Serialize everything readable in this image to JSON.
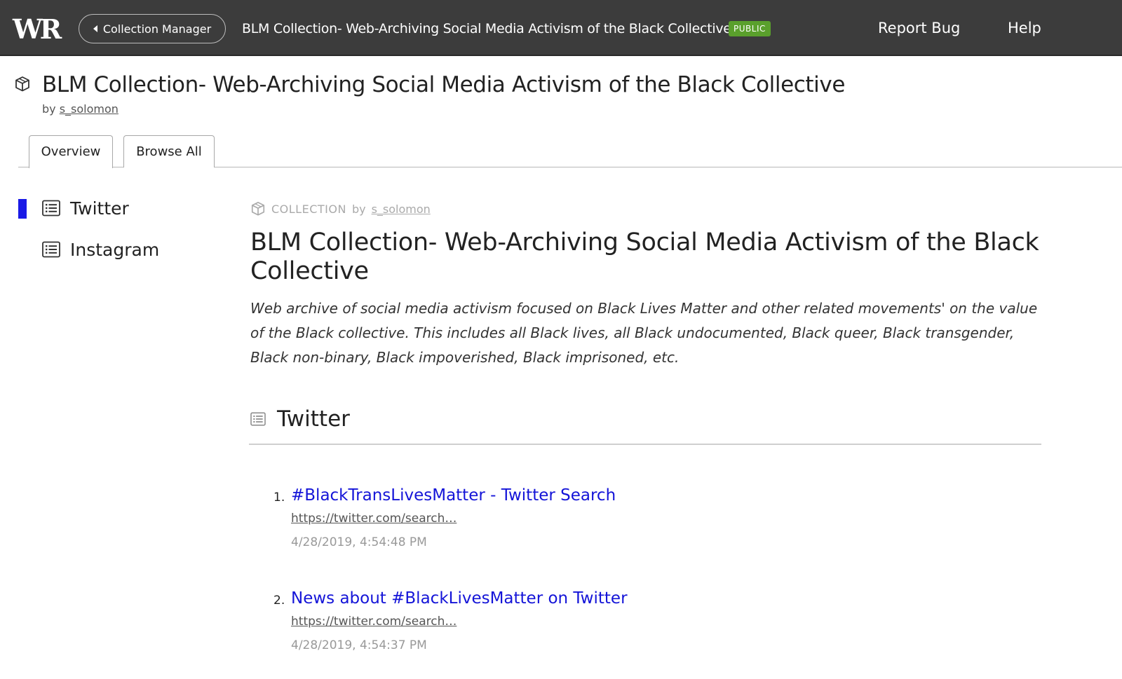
{
  "topbar": {
    "logo": "WR",
    "collection_manager_label": "Collection Manager",
    "title": "BLM Collection- Web-Archiving Social Media Activism of the Black Collective",
    "badge": "PUBLIC",
    "report_bug": "Report Bug",
    "help": "Help"
  },
  "header": {
    "title": "BLM Collection- Web-Archiving Social Media Activism of the Black Collective",
    "by_label": "by",
    "author": "s_solomon"
  },
  "tabs": [
    {
      "label": "Overview",
      "active": true
    },
    {
      "label": "Browse All",
      "active": false
    }
  ],
  "sidebar": {
    "items": [
      {
        "label": "Twitter",
        "active": true,
        "icon": "list-icon"
      },
      {
        "label": "Instagram",
        "active": false,
        "icon": "list-icon"
      }
    ]
  },
  "content": {
    "meta_type": "COLLECTION",
    "meta_by": "by",
    "meta_author": "s_solomon",
    "title": "BLM Collection- Web-Archiving Social Media Activism of the Black Collective",
    "description": "Web archive of social media activism focused on Black Lives Matter and other related movements' on the value of the Black collective. This includes all Black lives, all Black undocumented, Black queer, Black transgender, Black non-binary, Black impoverished, Black imprisoned, etc.",
    "section_title": "Twitter",
    "entries": [
      {
        "num": "1.",
        "title": "#BlackTransLivesMatter - Twitter Search",
        "url": "https://twitter.com/search…",
        "date": "4/28/2019, 4:54:48 PM"
      },
      {
        "num": "2.",
        "title": "News about #BlackLivesMatter on Twitter",
        "url": "https://twitter.com/search…",
        "date": "4/28/2019, 4:54:37 PM"
      }
    ]
  },
  "colors": {
    "topbar_bg": "#3c3c3c",
    "badge_green": "#5aa02c",
    "link_blue": "#1414d8",
    "active_marker": "#1a1ae6"
  }
}
